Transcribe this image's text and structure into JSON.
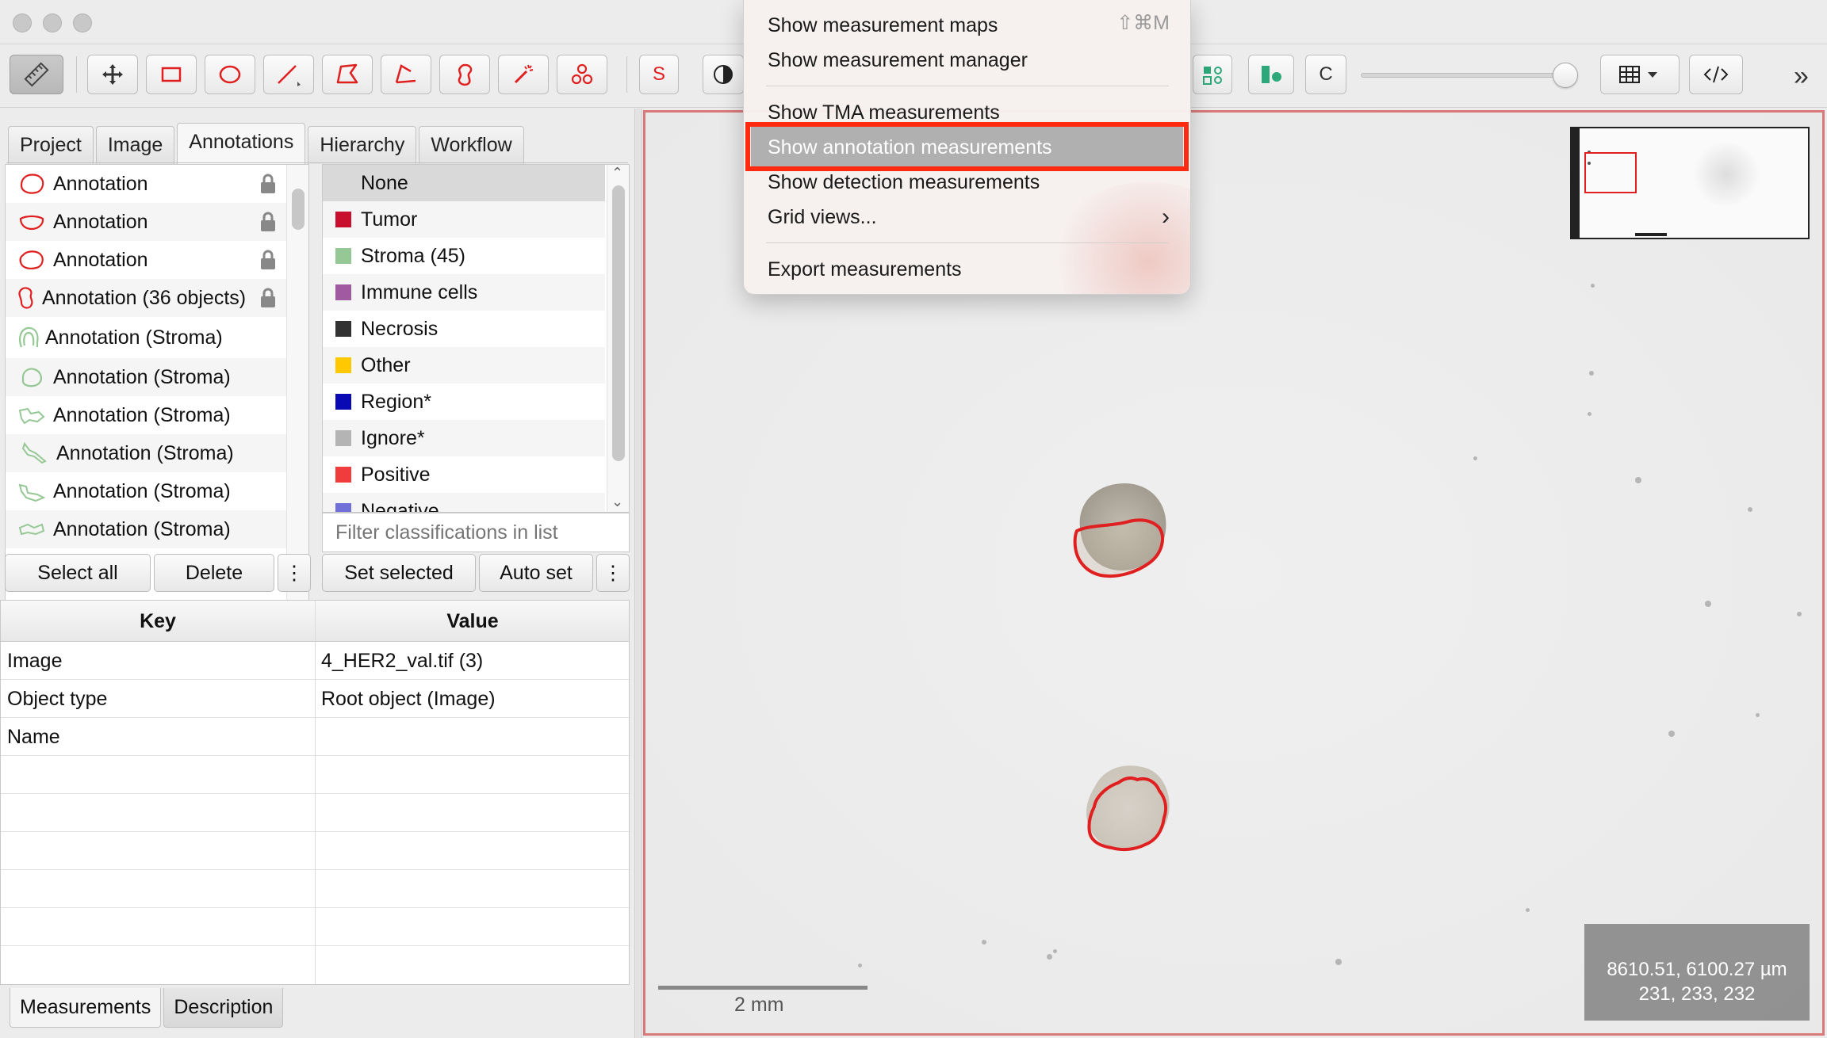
{
  "toolbar": {
    "brush_label": "S",
    "c_label": "C",
    "more_label": "»"
  },
  "left_tabs": [
    "Project",
    "Image",
    "Annotations",
    "Hierarchy",
    "Workflow"
  ],
  "annotations": [
    {
      "label": "Annotation",
      "locked": true
    },
    {
      "label": "Annotation",
      "locked": true
    },
    {
      "label": "Annotation",
      "locked": true
    },
    {
      "label": "Annotation (36 objects)",
      "locked": true
    },
    {
      "label": "Annotation (Stroma)",
      "locked": false
    },
    {
      "label": "Annotation (Stroma)",
      "locked": false
    },
    {
      "label": "Annotation (Stroma)",
      "locked": false
    },
    {
      "label": "Annotation (Stroma)",
      "locked": false
    },
    {
      "label": "Annotation (Stroma)",
      "locked": false
    },
    {
      "label": "Annotation (Stroma)",
      "locked": false
    }
  ],
  "classifications": [
    {
      "label": "None",
      "color": ""
    },
    {
      "label": "Tumor",
      "color": "#c8102e"
    },
    {
      "label": "Stroma (45)",
      "color": "#96c896"
    },
    {
      "label": "Immune cells",
      "color": "#a05aa0"
    },
    {
      "label": "Necrosis",
      "color": "#323232"
    },
    {
      "label": "Other",
      "color": "#ffc800"
    },
    {
      "label": "Region*",
      "color": "#0a0ab4"
    },
    {
      "label": "Ignore*",
      "color": "#b4b4b4"
    },
    {
      "label": "Positive",
      "color": "#f03c3c"
    },
    {
      "label": "Negative",
      "color": "#7070d8"
    }
  ],
  "filter": {
    "placeholder": "Filter classifications in list"
  },
  "buttons": {
    "select_all": "Select all",
    "delete": "Delete",
    "set_selected": "Set selected",
    "auto_set": "Auto set",
    "more": "⋮"
  },
  "table": {
    "headers": [
      "Key",
      "Value"
    ],
    "rows": [
      {
        "key": "Image",
        "value": "4_HER2_val.tif (3)"
      },
      {
        "key": "Object type",
        "value": "Root object (Image)"
      },
      {
        "key": "Name",
        "value": ""
      }
    ]
  },
  "bottom_tabs": [
    "Measurements",
    "Description"
  ],
  "viewer": {
    "scalebar_label": "2 mm",
    "coords_line1": "8610.51, 6100.27 µm",
    "coords_line2": "231, 233, 232",
    "accent": "#e02020"
  },
  "menu": {
    "items": [
      {
        "label": "Show measurement maps",
        "shortcut": "⇧⌘M"
      },
      {
        "label": "Show measurement manager"
      },
      {
        "label": "Show TMA measurements"
      },
      {
        "label": "Show annotation measurements",
        "highlighted": true
      },
      {
        "label": "Show detection measurements"
      },
      {
        "label": "Grid views...",
        "submenu": true
      },
      {
        "label": "Export measurements"
      }
    ],
    "submenu_arrow": "›"
  }
}
